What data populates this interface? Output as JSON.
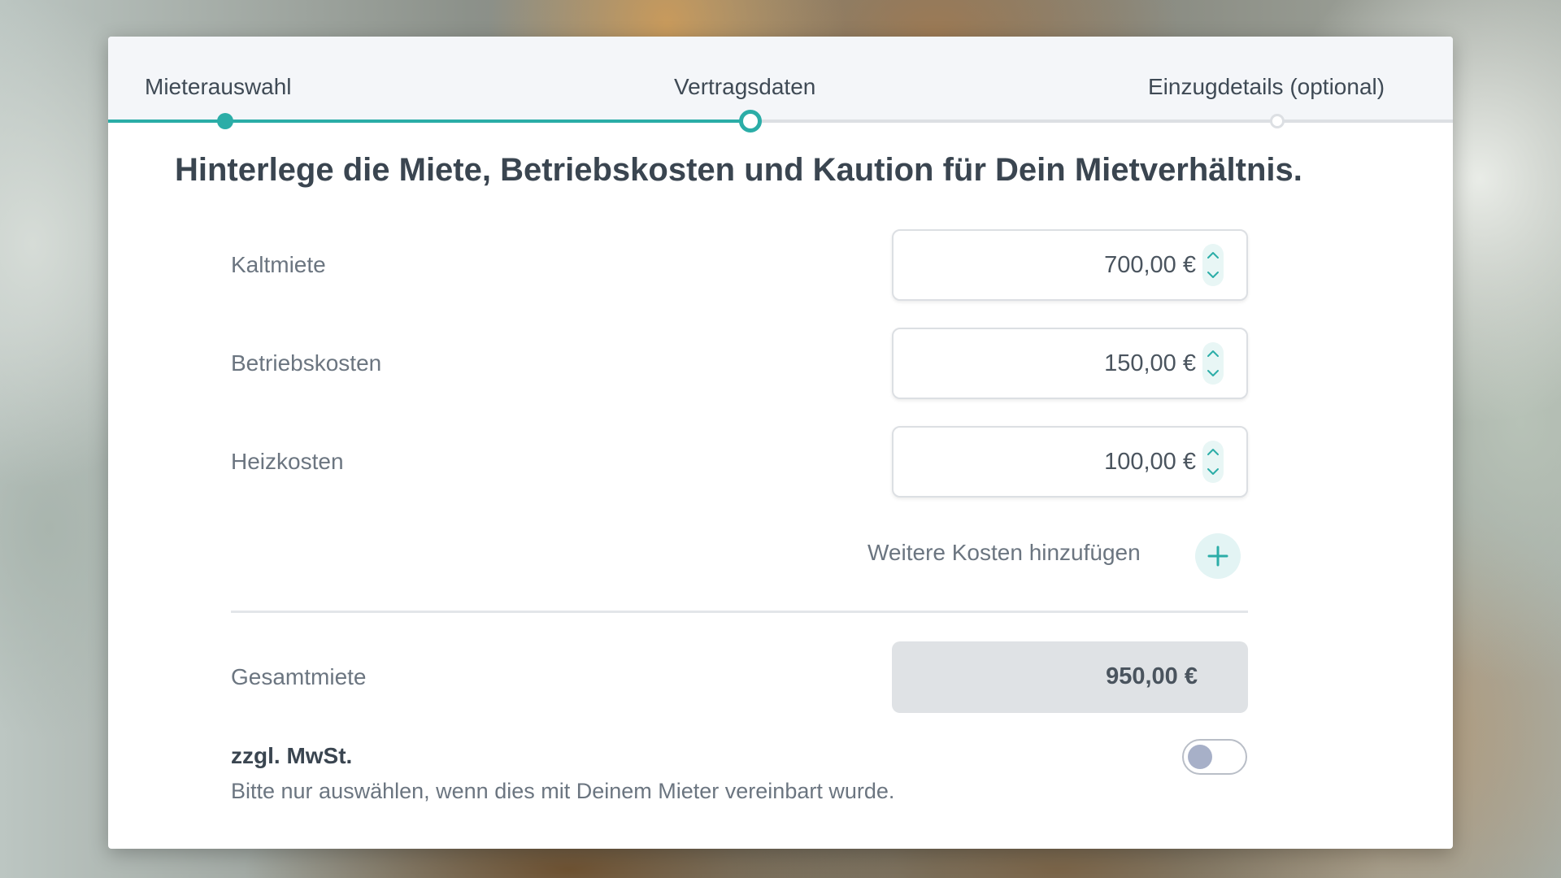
{
  "stepper": {
    "steps": [
      {
        "label": "Mieterauswahl",
        "state": "done"
      },
      {
        "label": "Vertragsdaten",
        "state": "current"
      },
      {
        "label": "Einzugdetails (optional)",
        "state": "upcoming"
      }
    ]
  },
  "headline": "Hinterlege die Miete, Betriebskosten und Kaution für Dein Mietverhältnis.",
  "costs": [
    {
      "label": "Kaltmiete",
      "value": "700,00 €"
    },
    {
      "label": "Betriebskosten",
      "value": "150,00 €"
    },
    {
      "label": "Heizkosten",
      "value": "100,00 €"
    }
  ],
  "add_costs_label": "Weitere Kosten hinzufügen",
  "total": {
    "label": "Gesamtmiete",
    "value": "950,00 €"
  },
  "vat": {
    "label": "zzgl. MwSt.",
    "hint": "Bitte nur auswählen, wenn dies mit Deinem Mieter vereinbart wurde.",
    "enabled": false
  },
  "colors": {
    "accent": "#2bada7",
    "text_dark": "#3a4550",
    "text_muted": "#6b7580"
  },
  "icons": {
    "add": "plus-icon",
    "stepper_up": "chevron-up-icon",
    "stepper_down": "chevron-down-icon"
  }
}
